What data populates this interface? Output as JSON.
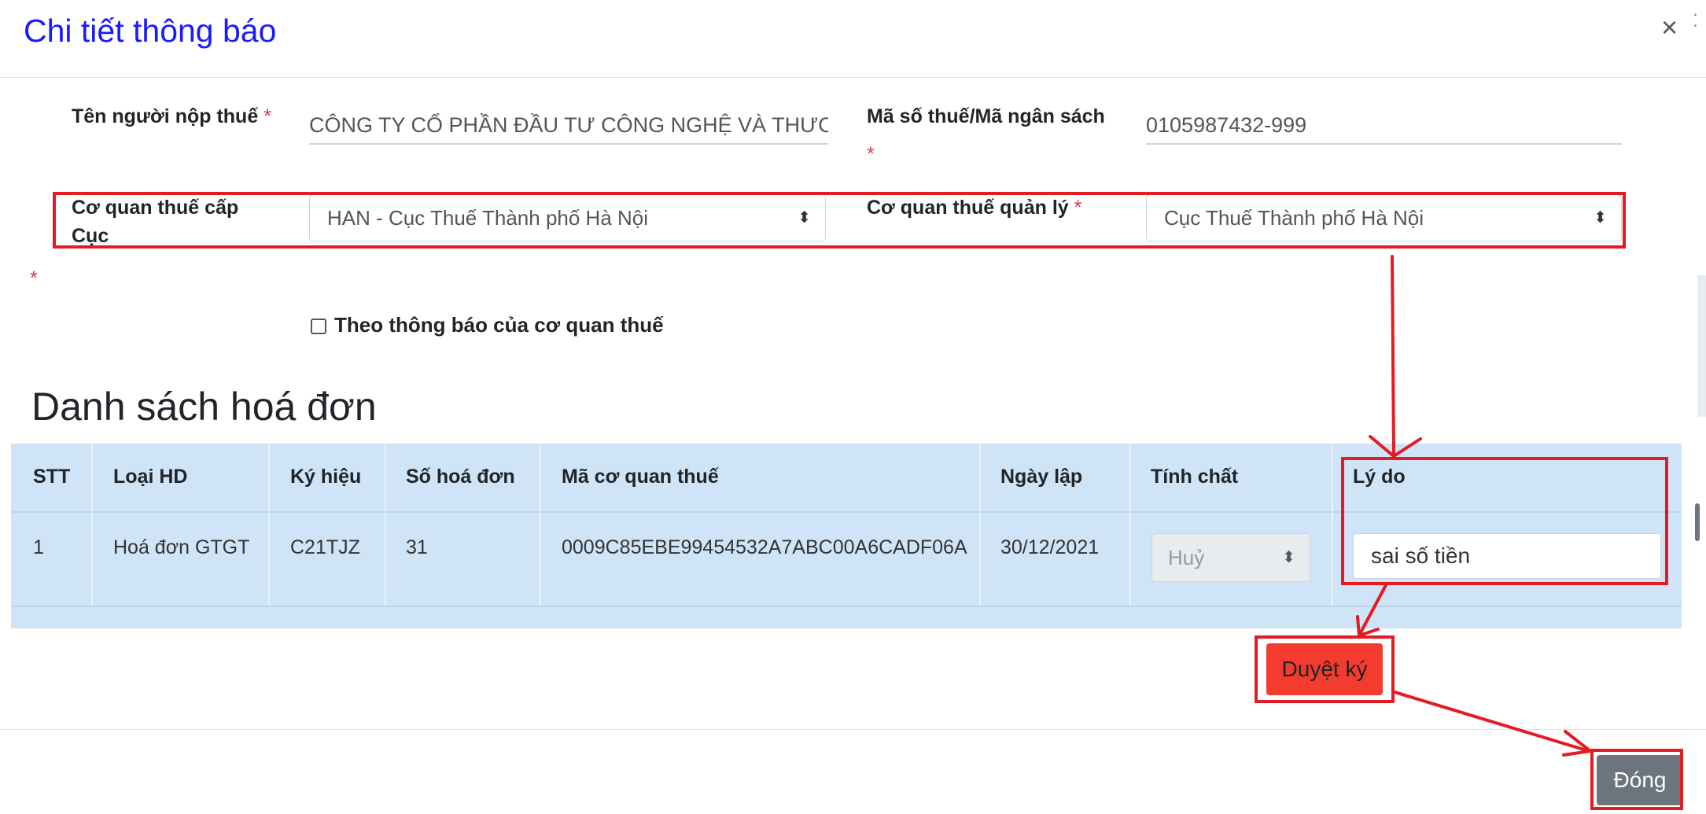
{
  "modal": {
    "title": "Chi tiết thông báo",
    "close_symbol": "×"
  },
  "form": {
    "taxpayer_label": "Tên người nộp thuế",
    "taxpayer_value": "CÔNG TY CỔ PHẦN ĐẦU TƯ CÔNG NGHỆ VÀ THƯƠNG",
    "tax_code_label": "Mã số thuế/Mã ngân sách",
    "tax_code_value": "0105987432-999",
    "issuing_office_label_1": "Cơ quan thuế cấp",
    "issuing_office_label_2": "Cục",
    "issuing_office_value": "HAN - Cục Thuế Thành phố Hà Nội",
    "managing_office_label": "Cơ quan thuế quản lý",
    "managing_office_value": "Cục Thuế Thành phố Hà Nội",
    "required_mark": "*",
    "notice_checkbox_label": "Theo thông báo của cơ quan thuế",
    "select_arrow": "⬍"
  },
  "invoices": {
    "title": "Danh sách hoá đơn",
    "columns": [
      "STT",
      "Loại HD",
      "Ký hiệu",
      "Số hoá đơn",
      "Mã cơ quan thuế",
      "Ngày lập",
      "Tính chất",
      "Lý do"
    ],
    "rows": [
      {
        "stt": "1",
        "type": "Hoá đơn GTGT",
        "symbol": "C21TJZ",
        "number": "31",
        "tax_office_code": "0009C85EBE99454532A7ABC00A6CADF06A",
        "date": "30/12/2021",
        "nature": "Huỷ",
        "reason": "sai số tiền"
      }
    ]
  },
  "actions": {
    "sign_label": "Duyệt ký",
    "close_label": "Đóng"
  },
  "colors": {
    "annotation": "#e31b23",
    "title": "#1a1aff",
    "table_bg": "#cfe4f7",
    "sign_button": "#f33b2f",
    "close_button": "#6c757d"
  }
}
